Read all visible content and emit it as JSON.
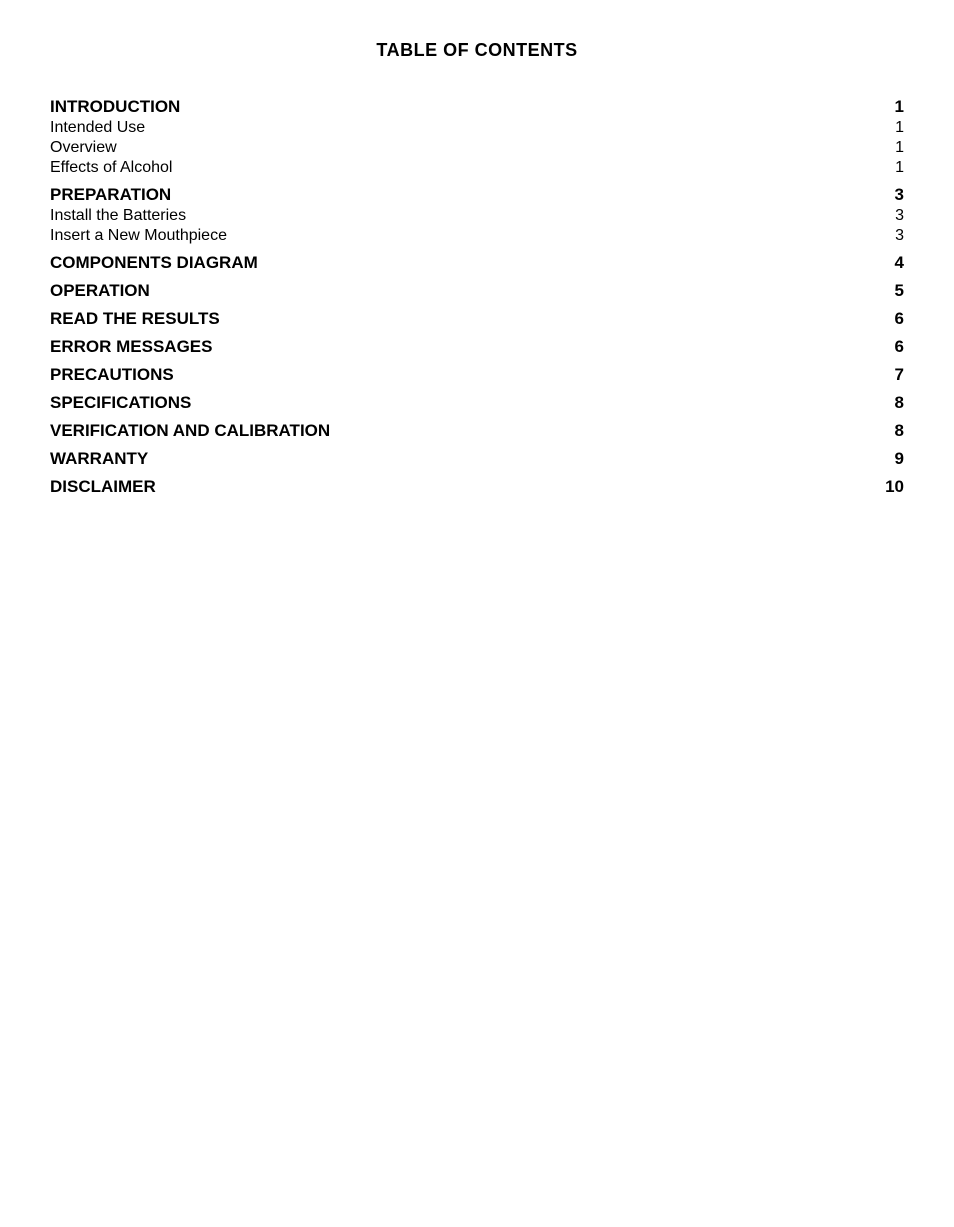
{
  "title": "TABLE OF CONTENTS",
  "sections": [
    {
      "label": "INTRODUCTION",
      "page": "1",
      "bold": true,
      "subsections": [
        {
          "label": "Intended Use",
          "page": "1"
        },
        {
          "label": "Overview",
          "page": "1"
        },
        {
          "label": "Effects of Alcohol",
          "page": "1"
        }
      ]
    },
    {
      "label": "PREPARATION",
      "page": "3",
      "bold": true,
      "subsections": [
        {
          "label": "Install the Batteries",
          "page": "3"
        },
        {
          "label": "Insert a New Mouthpiece",
          "page": "3"
        }
      ]
    },
    {
      "label": "COMPONENTS DIAGRAM",
      "page": "4",
      "bold": true,
      "subsections": []
    },
    {
      "label": "OPERATION",
      "page": "5",
      "bold": true,
      "subsections": []
    },
    {
      "label": "READ THE RESULTS",
      "page": "6",
      "bold": true,
      "subsections": []
    },
    {
      "label": "ERROR MESSAGES",
      "page": "6",
      "bold": true,
      "subsections": []
    },
    {
      "label": "PRECAUTIONS",
      "page": "7",
      "bold": true,
      "subsections": []
    },
    {
      "label": "SPECIFICATIONS",
      "page": "8",
      "bold": true,
      "subsections": []
    },
    {
      "label": "VERIFICATION AND CALIBRATION",
      "page": "8",
      "bold": true,
      "subsections": []
    },
    {
      "label": "WARRANTY",
      "page": "9",
      "bold": true,
      "subsections": []
    },
    {
      "label": "DISCLAIMER",
      "page": "10",
      "bold": true,
      "subsections": []
    }
  ]
}
